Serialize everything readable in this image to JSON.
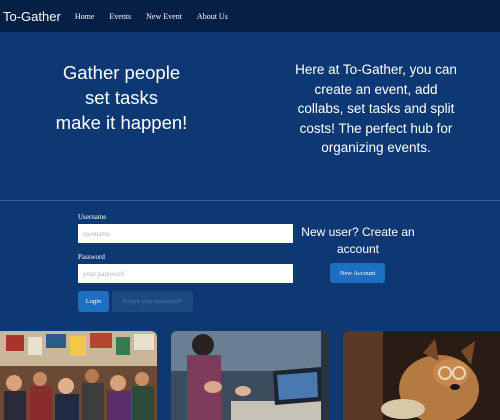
{
  "nav": {
    "brand": "To-Gather",
    "links": [
      "Home",
      "Events",
      "New Event",
      "About Us"
    ]
  },
  "hero": {
    "tagline": [
      "Gather people",
      "set tasks",
      "make it happen!"
    ],
    "about": "Here at To-Gather, you can create an event, add collabs, set tasks and split costs! The perfect hub for organizing events."
  },
  "login": {
    "username_label": "Username",
    "username_placeholder": "username",
    "password_label": "Password",
    "password_placeholder": "your password",
    "login_button": "Login",
    "forgot_button": "Forgot your password?"
  },
  "signup": {
    "prompt": "New user? Create an account",
    "button": "New Account"
  },
  "colors": {
    "navbar": "#061f45",
    "background": "#0d3873",
    "button_primary": "#1d6fc2"
  }
}
